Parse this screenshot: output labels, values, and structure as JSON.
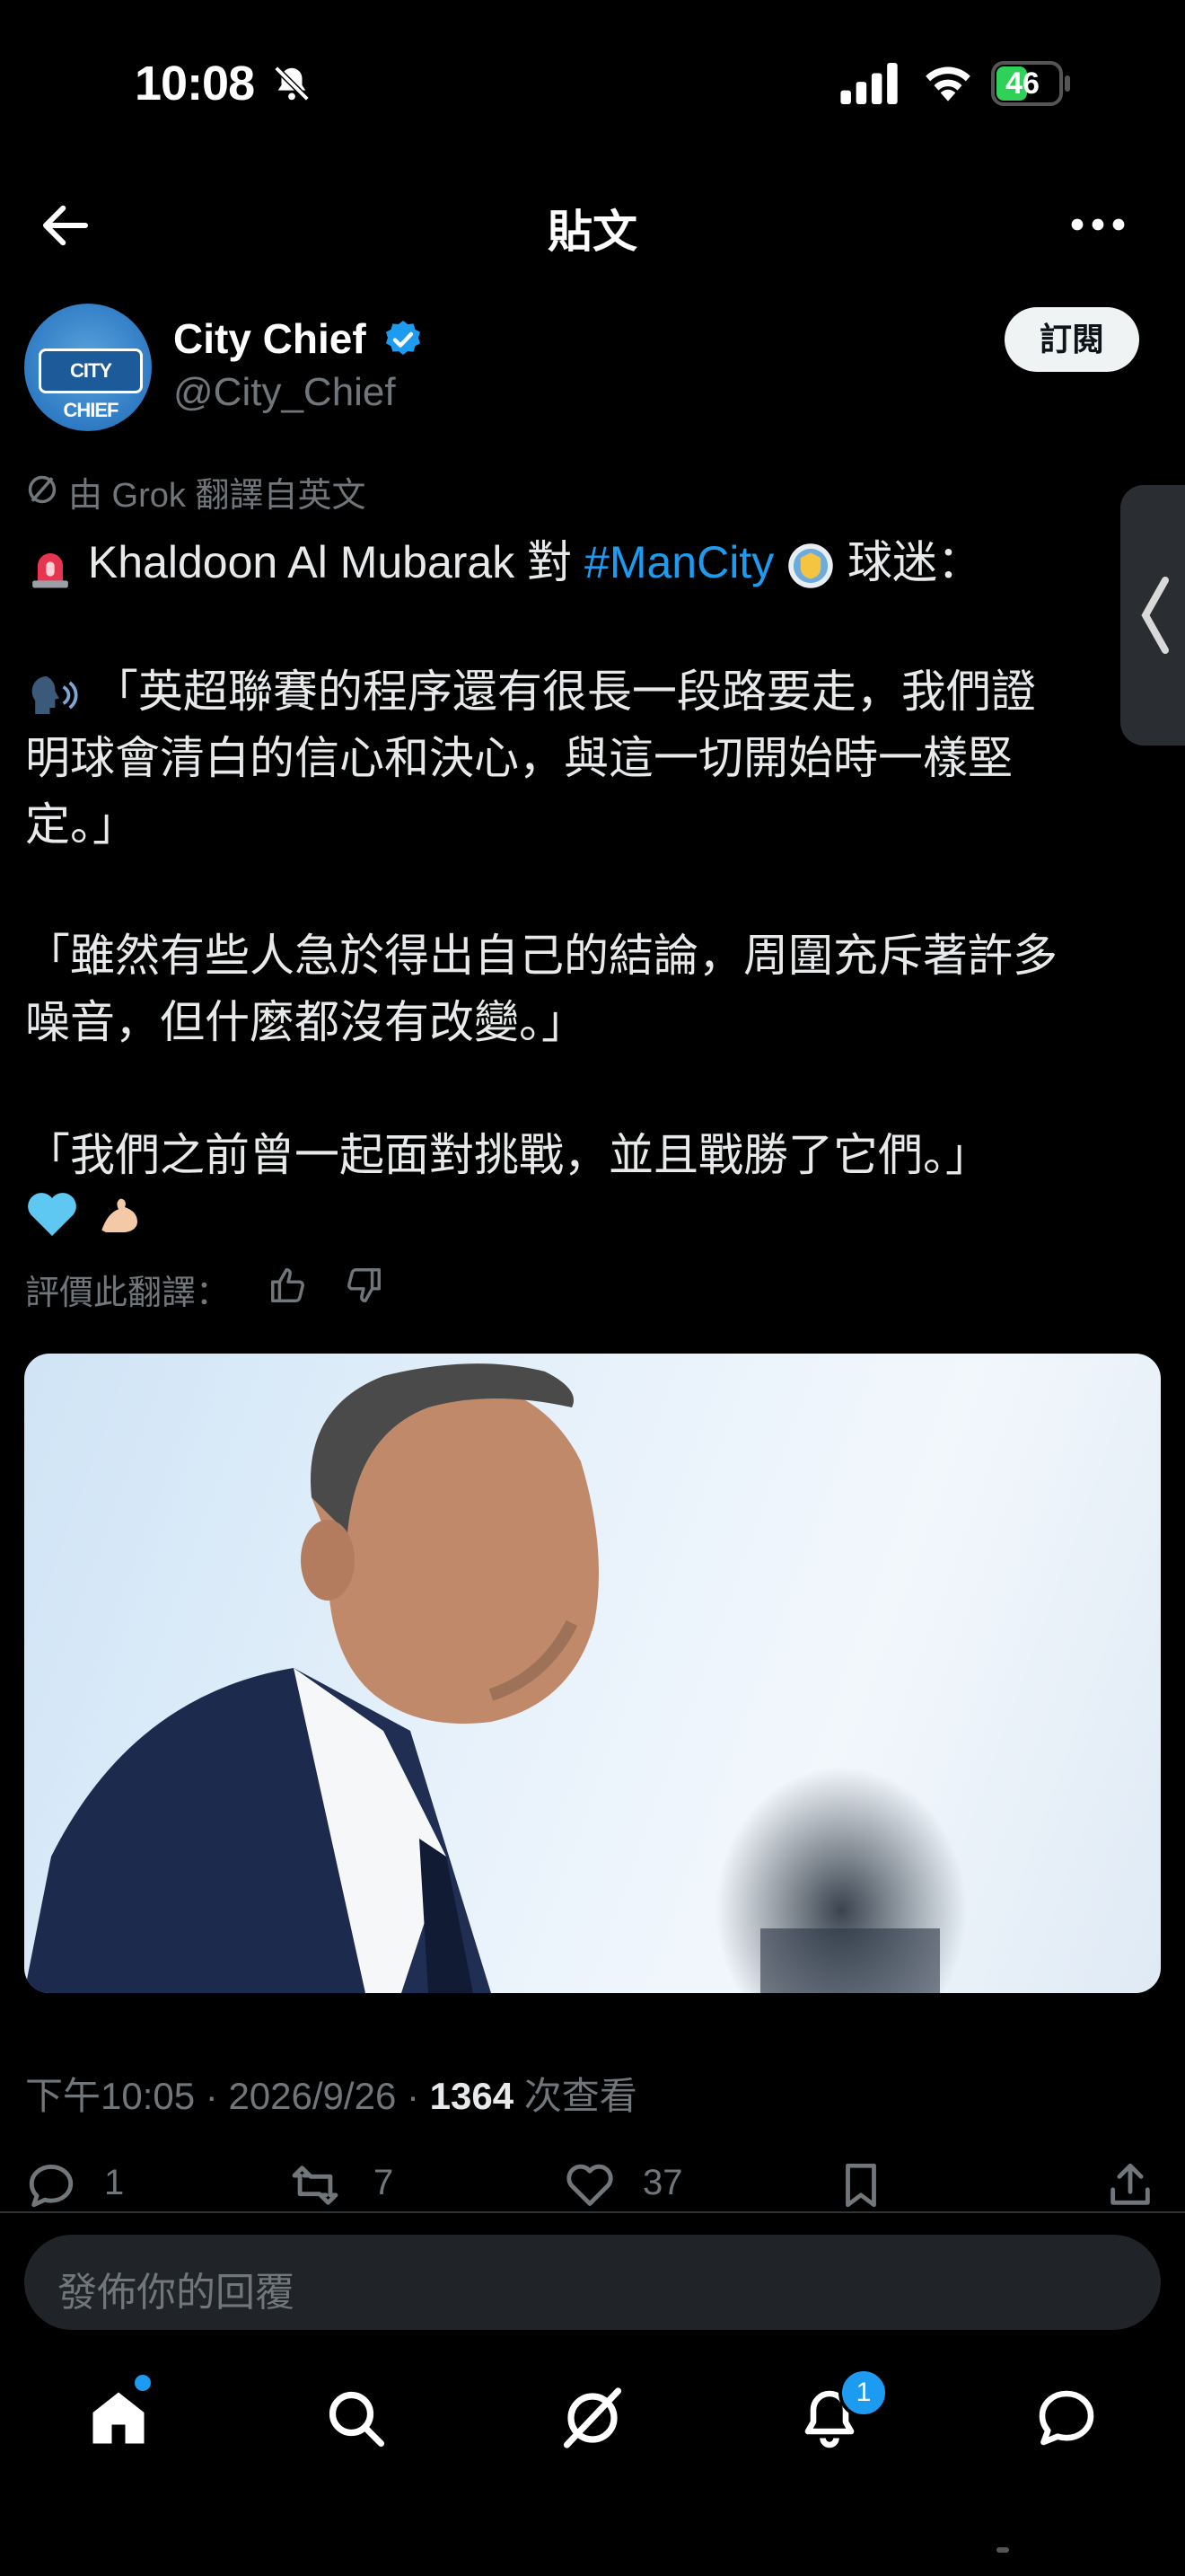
{
  "status_bar": {
    "time": "10:08",
    "battery": "46"
  },
  "header": {
    "title": "貼文"
  },
  "author": {
    "name": "City Chief",
    "handle": "@City_Chief",
    "avatar_text": "CITY CHIEF",
    "subscribe_label": "訂閱"
  },
  "translation_note": "由 Grok 翻譯自英文",
  "post": {
    "line1_pre": "Khaldoon Al Mubarak 對 ",
    "hashtag": "#ManCity",
    "line1_post": " 球迷：",
    "quote1_l1": "「英超聯賽的程序還有很長一段路要走，我們證",
    "quote1_l2": "明球會清白的信心和決心，與這一切開始時一樣堅",
    "quote1_l3": "定。」",
    "quote2_l1": "「雖然有些人急於得出自己的結論，周圍充斥著許多",
    "quote2_l2": "噪音，但什麼都沒有改變。」",
    "quote3_l1": "「我們之前曾一起面對挑戰，並且戰勝了它們。」"
  },
  "rate_translation_label": "評價此翻譯：",
  "meta": {
    "time": "下午10:05",
    "date": "2026/9/26",
    "views": "1364",
    "views_label": "次查看",
    "sep": "·"
  },
  "actions": {
    "replies": "1",
    "reposts": "7",
    "likes": "37"
  },
  "reply": {
    "placeholder": "發佈你的回覆"
  },
  "tabbar": {
    "notifications_badge": "1"
  },
  "colors": {
    "accent": "#1d9bf0",
    "background": "#000000",
    "muted": "#71767b"
  }
}
